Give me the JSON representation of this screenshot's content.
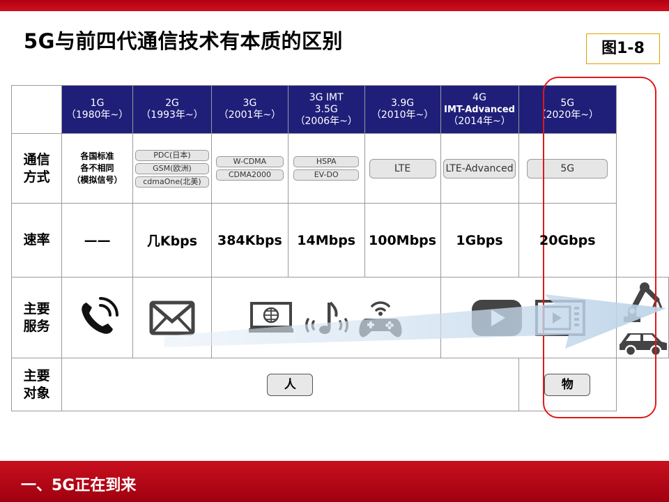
{
  "slide": {
    "title": "5G与前四代通信技术有本质的区别",
    "figure_label": "图1-8",
    "footer": "一、5G正在到来"
  },
  "table": {
    "generations": [
      {
        "name": "1G",
        "year": "（1980年~）"
      },
      {
        "name": "2G",
        "year": "（1993年~）"
      },
      {
        "name": "3G",
        "year": "（2001年~）"
      },
      {
        "name": "3G  IMT",
        "name2": "3.5G",
        "year": "（2006年~）"
      },
      {
        "name": "3.9G",
        "year": "（2010年~）"
      },
      {
        "name": "4G",
        "name2": "IMT-Advanced",
        "year": "（2014年~）"
      },
      {
        "name": "5G",
        "year": "（2020年~）"
      }
    ],
    "row_labels": {
      "comm": "通信\n方式",
      "rate": "速率",
      "service": "主要\n服务",
      "object": "主要\n对象"
    },
    "comm": {
      "g1": [
        "各国标准",
        "各不相同",
        "（模拟信号）"
      ],
      "g2": [
        "PDC(日本)",
        "GSM(欧洲)",
        "cdmaOne(北美)"
      ],
      "g3": [
        "W-CDMA",
        "CDMA2000"
      ],
      "g35": [
        "HSPA",
        "EV-DO"
      ],
      "g39": "LTE",
      "g4": "LTE-Advanced",
      "g5": "5G"
    },
    "rates": [
      "——",
      "几Kbps",
      "384Kbps",
      "14Mbps",
      "100Mbps",
      "1Gbps",
      "20Gbps"
    ],
    "service_icons": [
      "phone-icon",
      "mail-icon",
      "web-icon",
      "music-icon",
      "gamepad-icon",
      "video-play-icon",
      "video-screen-icon",
      "robot-arm-icon",
      "car-icon"
    ],
    "objects": {
      "people": "人",
      "things": "物"
    }
  },
  "colors": {
    "header_bg": "#1f1f7a",
    "accent_red": "#c8101e",
    "highlight_border": "#e01818"
  }
}
